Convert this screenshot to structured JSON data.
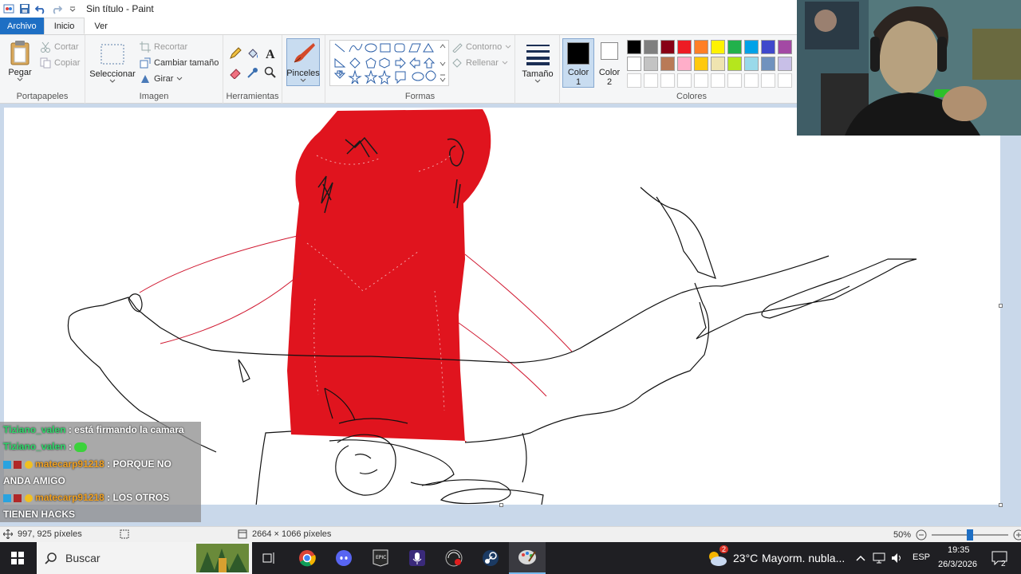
{
  "window": {
    "title": "Sin título - Paint"
  },
  "tabs": [
    {
      "label": "Archivo"
    },
    {
      "label": "Inicio"
    },
    {
      "label": "Ver"
    }
  ],
  "ribbon": {
    "clipboard": {
      "paste": "Pegar",
      "cut": "Cortar",
      "copy": "Copiar",
      "label": "Portapapeles"
    },
    "image": {
      "select": "Seleccionar",
      "crop": "Recortar",
      "resize": "Cambiar tamaño",
      "rotate": "Girar",
      "label": "Imagen"
    },
    "tools": {
      "label": "Herramientas"
    },
    "brushes": {
      "label": "Pinceles"
    },
    "shapes": {
      "outline": "Contorno",
      "fill": "Rellenar",
      "label": "Formas"
    },
    "size": {
      "label": "Tamaño"
    },
    "color1": {
      "label1": "Color",
      "label2": "1",
      "value": "#000000"
    },
    "color2": {
      "label1": "Color",
      "label2": "2",
      "value": "#ffffff"
    },
    "colors": {
      "label": "Colores",
      "row1": [
        "#000000",
        "#7f7f7f",
        "#880015",
        "#ed1c24",
        "#ff7f27",
        "#fff200",
        "#22b14c",
        "#00a2e8",
        "#3f48cc",
        "#a349a4"
      ],
      "row2": [
        "#ffffff",
        "#c3c3c3",
        "#b97a57",
        "#ffaec9",
        "#ffc90e",
        "#efe4b0",
        "#b5e61d",
        "#99d9ea",
        "#7092be",
        "#c8bfe7"
      ]
    }
  },
  "chat": {
    "messages": [
      {
        "user": "Tiziano_valen",
        "text": ": está firmando la camara"
      },
      {
        "user": "Tiziano_valen",
        "text": ":"
      },
      {
        "user": "matecarp91218",
        "text": ": PORQUE NO",
        "cont": "ANDA AMIGO"
      },
      {
        "user": "matecarp91218",
        "text": ": LOS OTROS",
        "cont": "TIENEN HACKS"
      }
    ]
  },
  "status": {
    "cursor": "997, 925 píxeles",
    "size": "2664 × 1066 píxeles",
    "zoom": "50%",
    "zoom_level": 0.5
  },
  "taskbar": {
    "search": "Buscar",
    "weather_badge": "2",
    "weather_temp": "23°C",
    "weather_desc": "Mayorm. nubla...",
    "lang": "ESP",
    "time": "19:35",
    "date": "26/3/2026",
    "notifications": "2"
  }
}
